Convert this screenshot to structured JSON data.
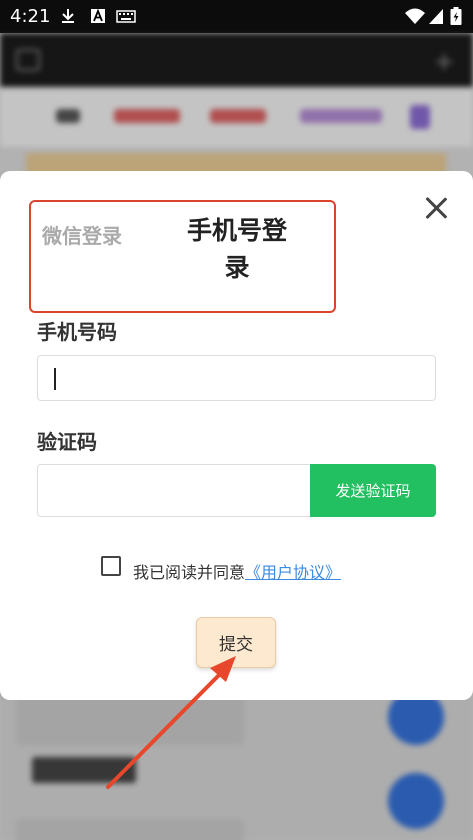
{
  "status_bar": {
    "time": "4:21",
    "icons_left": [
      "download-icon",
      "a-icon",
      "keyboard-icon"
    ],
    "icons_right": [
      "wifi-icon",
      "signal-icon",
      "battery-icon"
    ]
  },
  "dialog": {
    "tabs": {
      "wechat_label": "微信登录",
      "phone_label": "手机号登录"
    },
    "phone": {
      "label": "手机号码",
      "value": ""
    },
    "code": {
      "label": "验证码",
      "value": "",
      "send_label": "发送验证码"
    },
    "agreement": {
      "text": "我已阅读并同意",
      "link": "《用户协议》",
      "checked": false
    },
    "submit_label": "提交"
  },
  "colors": {
    "highlight_border": "#d8442c",
    "send_button": "#23c062",
    "submit_bg": "#fde9cf",
    "link": "#3b8be0",
    "arrow": "#e8472c"
  }
}
